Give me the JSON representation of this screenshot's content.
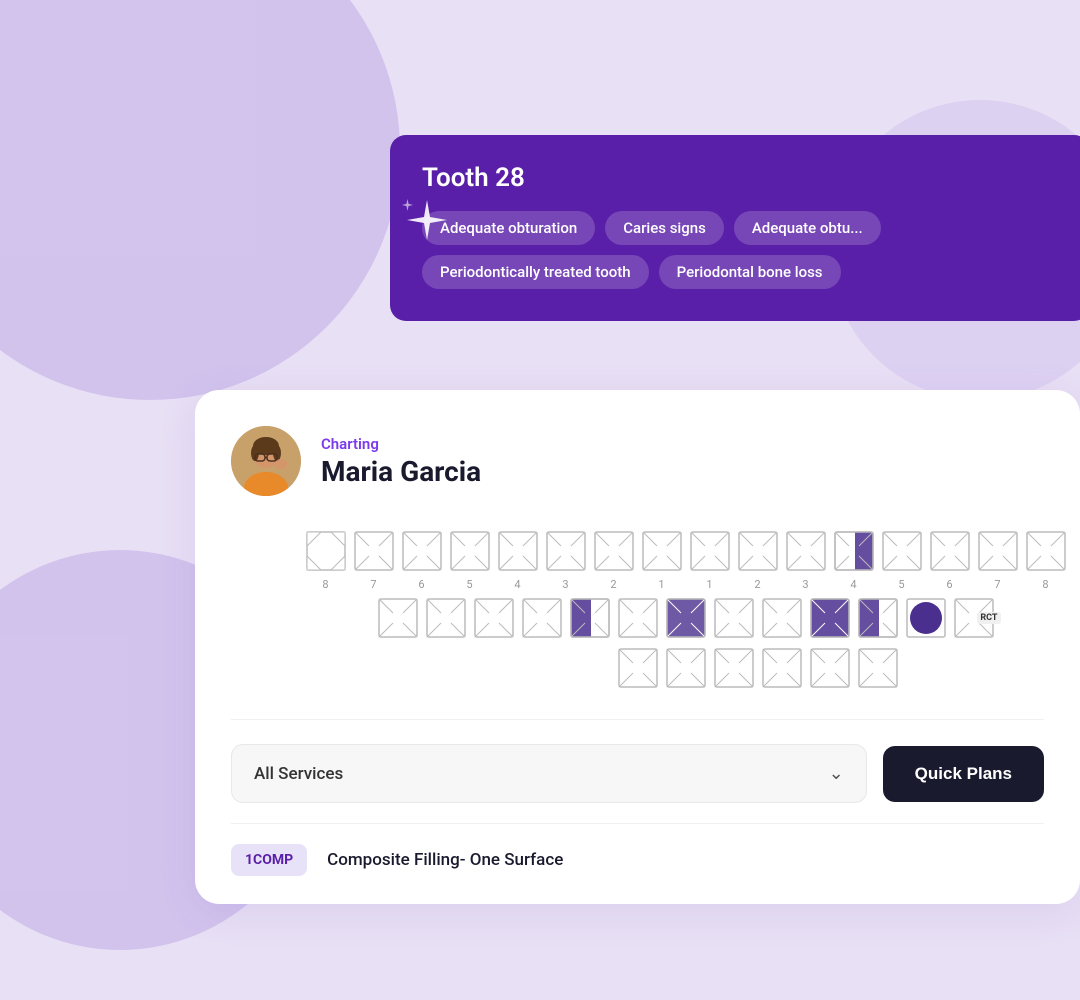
{
  "background": {
    "color": "#e8e0f5"
  },
  "tooltip": {
    "tooth_label": "Tooth 28",
    "tags": [
      "Adequate obturation",
      "Caries signs",
      "Adequate obtu...",
      "Periodontically treated tooth",
      "Periodontal bone loss"
    ]
  },
  "charting": {
    "section_label": "Charting",
    "patient_name": "Maria Garcia"
  },
  "teeth": {
    "upper_numbers_left": [
      "8",
      "7",
      "6",
      "5",
      "4",
      "3",
      "2",
      "1"
    ],
    "upper_numbers_right": [
      "1",
      "2",
      "3",
      "4",
      "5",
      "6",
      "7",
      "8"
    ],
    "lower_numbers_left": [],
    "lower_numbers_right": []
  },
  "services": {
    "dropdown_label": "All Services",
    "dropdown_placeholder": "All Services",
    "quick_plans_label": "Quick Plans",
    "service_code": "1COMP",
    "service_name": "Composite Filling- One Surface"
  }
}
